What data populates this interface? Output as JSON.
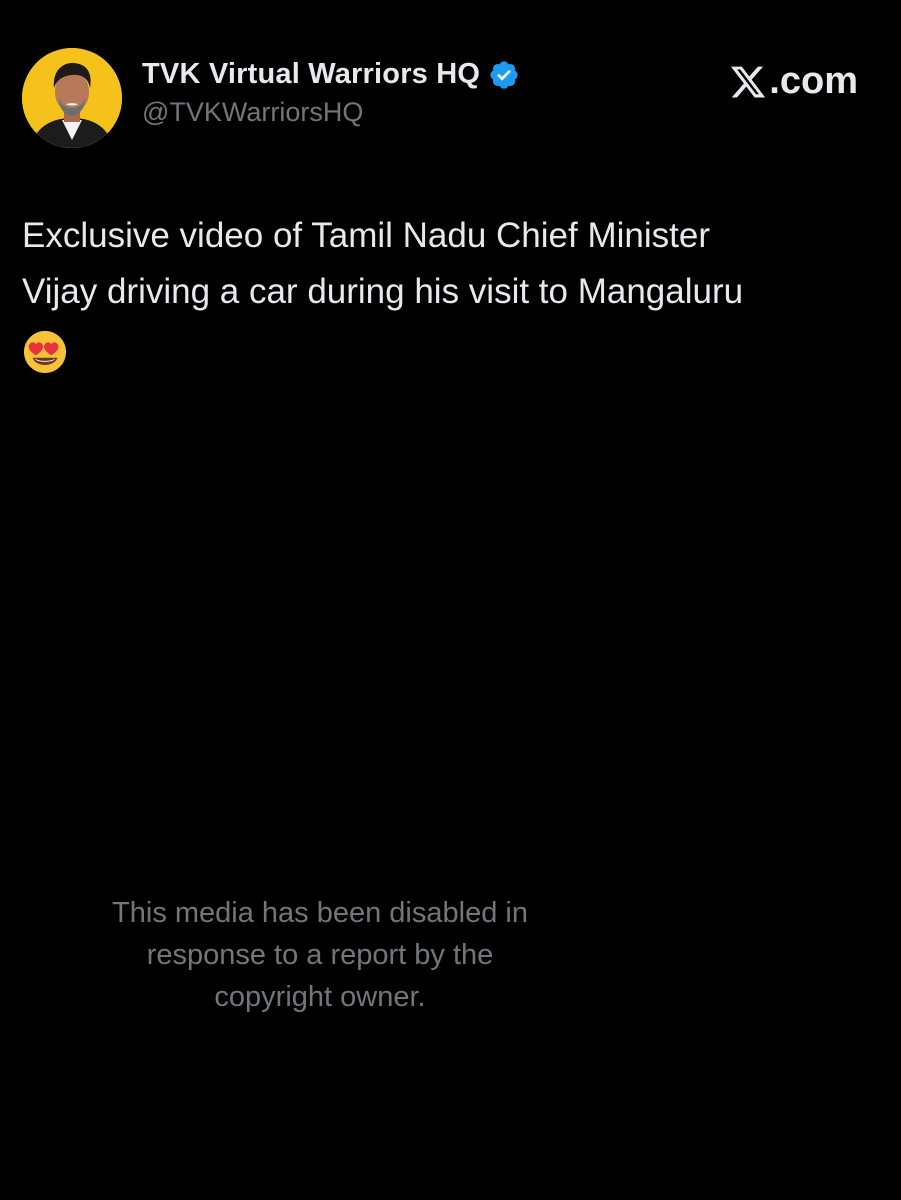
{
  "header": {
    "display_name": "TVK Virtual Warriors HQ",
    "handle": "@TVKWarriorsHQ",
    "verified": true,
    "brand": ".com",
    "brand_icon": "x-logo-icon",
    "avatar_icon": "avatar-portrait"
  },
  "post": {
    "text_lines": [
      "Exclusive video of Tamil Nadu Chief Minister",
      "Vijay driving a car during his visit to Mangaluru"
    ],
    "emoji": "heart-eyes-emoji-icon"
  },
  "media_notice": {
    "lines": [
      "This media has been disabled in",
      "response to a report by the",
      "copyright owner."
    ]
  },
  "colors": {
    "background": "#000000",
    "primary_text": "#e7e9ea",
    "secondary_text": "#71767b",
    "verified_blue": "#1d9bf0",
    "avatar_bg": "#f4c21a"
  }
}
